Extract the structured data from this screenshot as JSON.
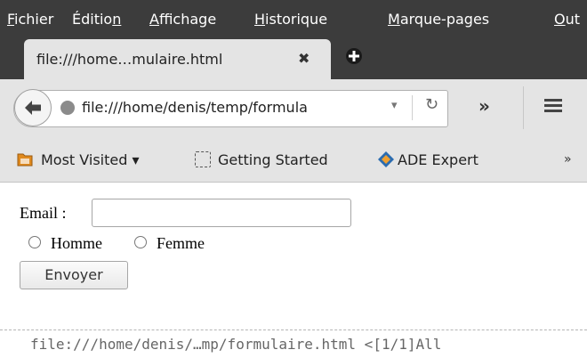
{
  "menu": [
    {
      "label": "Fichier",
      "accel": "F",
      "rest": "ichier"
    },
    {
      "label": "Édition",
      "pre": "Éditio",
      "accel": "n",
      "rest": ""
    },
    {
      "label": "Affichage",
      "accel": "A",
      "rest": "ffichage"
    },
    {
      "label": "Historique",
      "accel": "H",
      "rest": "istorique"
    },
    {
      "label": "Marque-pages",
      "accel": "M",
      "rest": "arque-pages"
    },
    {
      "label": "Outils",
      "accel": "O",
      "rest": "ut"
    }
  ],
  "tab": {
    "title": "file:///home…mulaire.html",
    "close": "✖"
  },
  "navbar": {
    "url": "file:///home/denis/temp/formula",
    "dropmarker": "▾",
    "reload": "↻",
    "overflow": "»"
  },
  "bookmarks": {
    "most_visited": "Most Visited ▾",
    "getting_started": "Getting Started",
    "ade_expert": "ADE Expert",
    "more": "»"
  },
  "form": {
    "email_label": "Email :",
    "email_value": "",
    "radio_homme": "Homme",
    "radio_femme": "Femme",
    "submit": "Envoyer"
  },
  "status": {
    "text": "file:///home/denis/…mp/formulaire.html <[1/1]All"
  },
  "colors": {
    "chrome_dark": "#3c3c3c",
    "toolbar": "#e4e4e4"
  }
}
